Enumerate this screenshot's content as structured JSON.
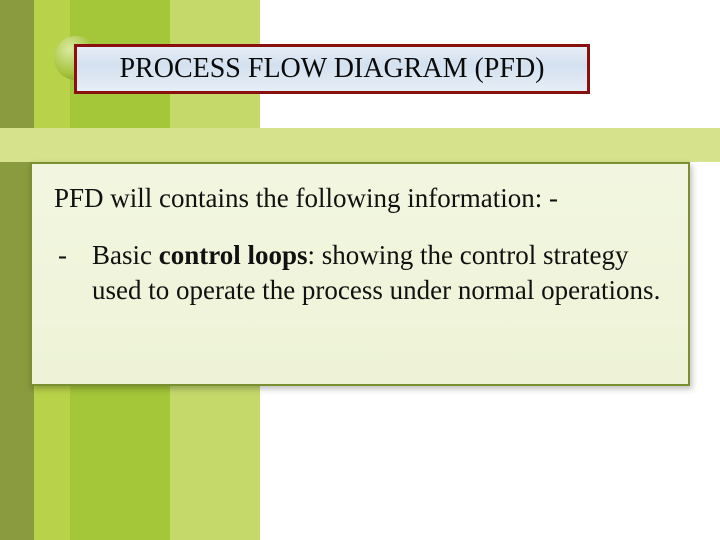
{
  "title": "PROCESS FLOW DIAGRAM (PFD)",
  "content": {
    "intro": "PFD will contains the following information: -",
    "items": [
      {
        "dash": "-",
        "seg1": "Basic ",
        "bold": "control loops",
        "seg2": ": showing the control strategy used to operate the process under normal operations."
      }
    ]
  }
}
